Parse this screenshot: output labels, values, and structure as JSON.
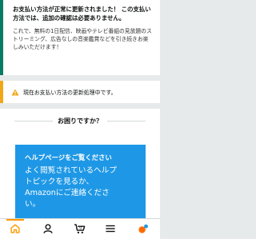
{
  "success_message": {
    "heading": "お支払い方法が正常に更新されました！ この支払い方法では、追加の確認は必要ありません。",
    "body": "これで、無料の1日配信、映画やテレビ番組の見放題のストリーミング、広告なしの音楽鑑賞などを引き続きお楽しみいただけます！"
  },
  "alert": {
    "icon": "warning-icon",
    "text": "現在お支払い方法の更新処理中です。"
  },
  "help": {
    "title": "お困りですか？",
    "button_title": "ヘルプページをご覧ください",
    "button_body": "よく閲覧されているヘルプ\nトピックを見るか、\nAmazonにご連絡くださ\nい。"
  },
  "bottom_nav": {
    "active": "home",
    "items": [
      "home-icon",
      "account-icon",
      "cart-icon",
      "menu-icon",
      "assistant-icon"
    ]
  },
  "colors": {
    "success_accent": "#067d62",
    "alert_accent": "#f0a818",
    "help_button": "#1e98e6",
    "nav_active": "#ff9900",
    "assistant_orange": "#ff6a00",
    "assistant_blue": "#1e98e6"
  }
}
